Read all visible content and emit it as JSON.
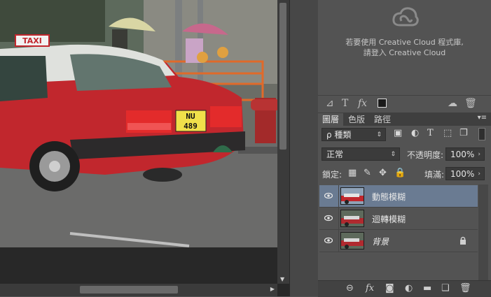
{
  "creative_cloud": {
    "line1": "若要使用 Creative Cloud 程式庫,",
    "line2": "請登入 Creative Cloud"
  },
  "tabs": [
    {
      "label": "圖層",
      "active": true
    },
    {
      "label": "色版",
      "active": false
    },
    {
      "label": "路徑",
      "active": false
    }
  ],
  "filter": {
    "kind_label": "ρ 種類"
  },
  "blend": {
    "mode": "正常",
    "opacity_label": "不透明度:",
    "opacity_value": "100%"
  },
  "lock": {
    "label": "鎖定:",
    "fill_label": "填滿:",
    "fill_value": "100%"
  },
  "layers": [
    {
      "name": "動態模糊",
      "selected": true,
      "locked": false,
      "visible": true
    },
    {
      "name": "迴轉模糊",
      "selected": false,
      "locked": false,
      "visible": true
    },
    {
      "name": "背景",
      "selected": false,
      "locked": true,
      "visible": true
    }
  ],
  "photo": {
    "taxi_sign": "TAXI",
    "plate_line1": "NU",
    "plate_line2": "489"
  },
  "colors": {
    "selection": "#6a7b92",
    "panel": "#535353",
    "taxi_red": "#c1272d"
  }
}
